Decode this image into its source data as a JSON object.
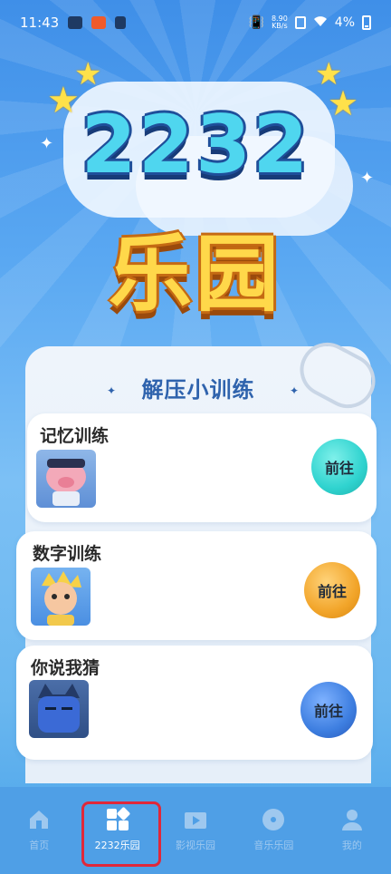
{
  "status_bar": {
    "time": "11:43",
    "net_speed_value": "8.90",
    "net_speed_unit": "KB/s",
    "battery": "4%"
  },
  "hero": {
    "number": "2232",
    "title": "乐园"
  },
  "panel": {
    "title": "解压小训练"
  },
  "cards": [
    {
      "title": "记忆训练",
      "button_label": "前往",
      "button_color": "#2fd3cf"
    },
    {
      "title": "数字训练",
      "button_label": "前往",
      "button_color": "#f2a52a"
    },
    {
      "title": "你说我猜",
      "button_label": "前往",
      "button_color": "#3d7ee0"
    }
  ],
  "tabbar": {
    "items": [
      {
        "label": "首页",
        "icon": "home-icon",
        "active": false
      },
      {
        "label": "2232乐园",
        "icon": "apps-grid-icon",
        "active": true
      },
      {
        "label": "影视乐园",
        "icon": "film-icon",
        "active": false
      },
      {
        "label": "音乐乐园",
        "icon": "music-disc-icon",
        "active": false
      },
      {
        "label": "我的",
        "icon": "person-icon",
        "active": false
      }
    ]
  },
  "colors": {
    "accent": "#3f8fe8",
    "highlight_border": "#e0283a"
  }
}
